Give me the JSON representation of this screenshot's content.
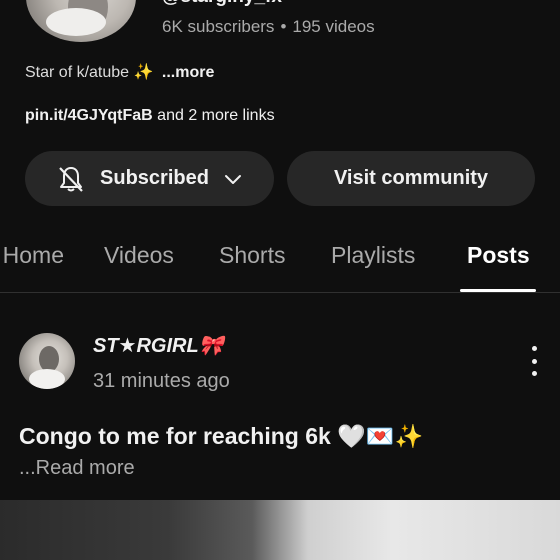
{
  "channel": {
    "handle": "@starginy_fx",
    "subscribers": "6K subscribers",
    "separator": "•",
    "videos": "195 videos",
    "description": "Star of k/atube ✨",
    "description_more": "...more",
    "link_url": "pin.it/4GJYqtFaB",
    "link_more": "and 2 more links"
  },
  "buttons": {
    "subscribed": "Subscribed",
    "visit_community": "Visit community"
  },
  "tabs": [
    {
      "label": "Home",
      "active": false
    },
    {
      "label": "Videos",
      "active": false
    },
    {
      "label": "Shorts",
      "active": false
    },
    {
      "label": "Playlists",
      "active": false
    },
    {
      "label": "Posts",
      "active": true
    }
  ],
  "post": {
    "author": "ST★RGIRL🎀",
    "time": "31 minutes ago",
    "text": "Congo to me for reaching 6k 🤍💌✨",
    "read_more": "...Read more"
  },
  "icons": {
    "bell": "bell-off-icon",
    "chevron": "chevron-down-icon",
    "more": "more-vertical-icon"
  }
}
